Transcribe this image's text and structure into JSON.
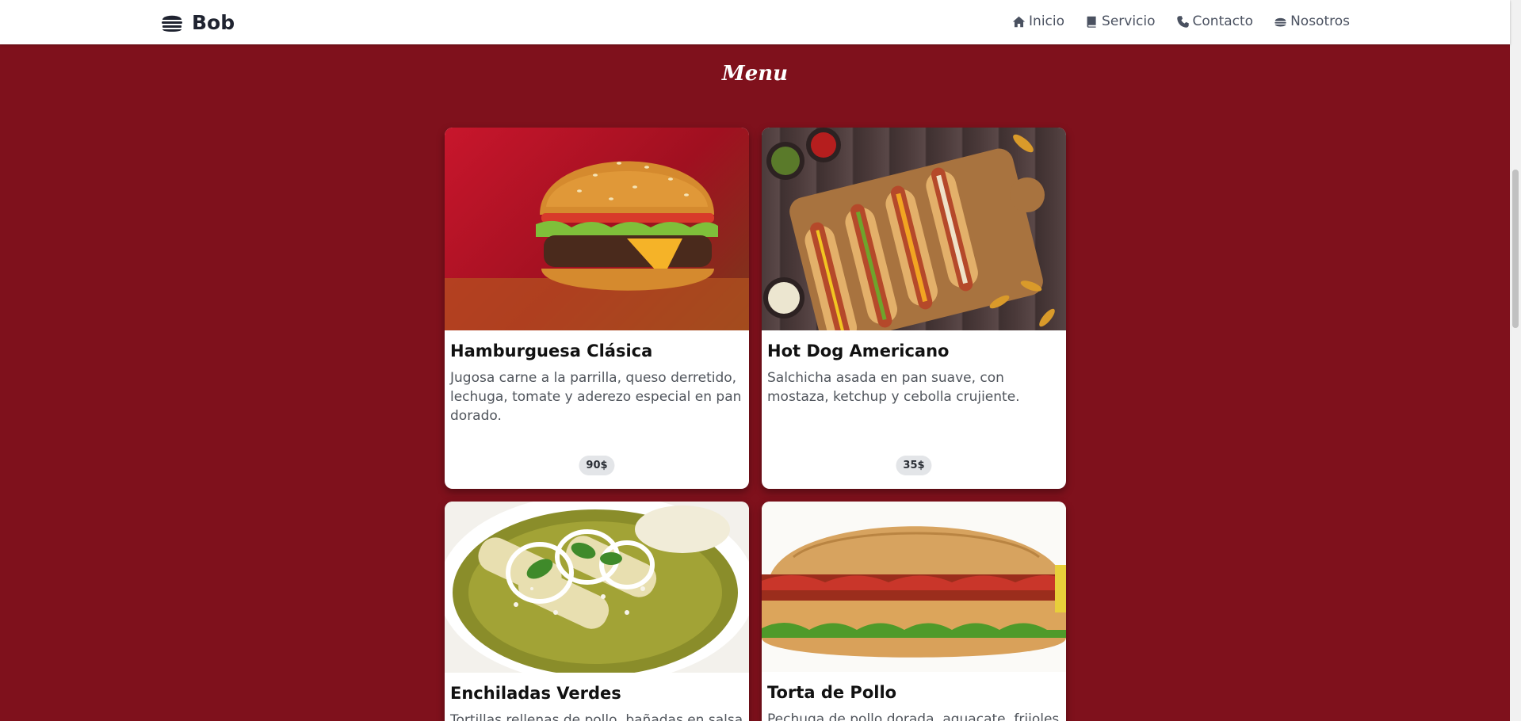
{
  "brand": {
    "name": "Bob",
    "icon": "burger-icon"
  },
  "nav": [
    {
      "label": "Inicio",
      "icon": "home-icon"
    },
    {
      "label": "Servicio",
      "icon": "book-icon"
    },
    {
      "label": "Contacto",
      "icon": "phone-icon"
    },
    {
      "label": "Nosotros",
      "icon": "burger-icon"
    }
  ],
  "section": {
    "title": "Menu"
  },
  "colors": {
    "background": "#7f111c",
    "navbar": "#ffffff",
    "price_badge": "#e3e5e8"
  },
  "menu": [
    {
      "title": "Hamburguesa Clásica",
      "description": "Jugosa carne a la parrilla, queso derretido, lechuga, tomate y aderezo especial en pan dorado.",
      "price": "90$"
    },
    {
      "title": "Hot Dog Americano",
      "description": "Salchicha asada en pan suave, con mostaza, ketchup y cebolla crujiente.",
      "price": "35$"
    },
    {
      "title": "Enchiladas Verdes",
      "description": "Tortillas rellenas de pollo, bañadas en salsa"
    },
    {
      "title": "Torta de Pollo",
      "description": "Pechuga de pollo dorada, aguacate, frijoles y"
    }
  ]
}
